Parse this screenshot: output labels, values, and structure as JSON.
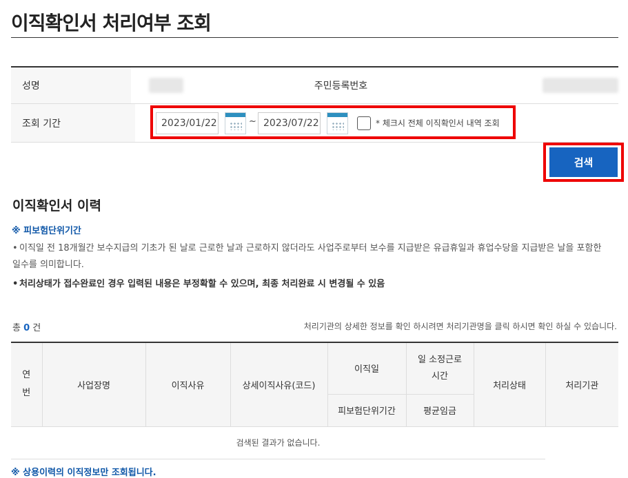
{
  "page": {
    "title": "이직확인서 처리여부 조회"
  },
  "form": {
    "name_label": "성명",
    "id_label": "주민등록번호",
    "period_label": "조회 기간",
    "start_date": "2023/01/22",
    "end_date": "2023/07/22",
    "tilde": "~",
    "check_note": "* 체크시 전체 이직확인서 내역 조회",
    "search_label": "검색"
  },
  "history": {
    "title": "이직확인서 이력",
    "note_head": "※ 피보험단위기간",
    "bullet1": "이직일 전 18개월간 보수지급의 기초가 된 날로 근로한 날과 근로하지 않더라도 사업주로부터 보수를 지급받은 유급휴일과 휴업수당을 지급받은 날을 포함한 일수를 의미합니다.",
    "bullet2": "처리상태가 접수완료인 경우 입력된 내용은 부정확할 수 있으며, 최종 처리완료 시 변경될 수 있음",
    "total_prefix": "총",
    "total_count": "0",
    "total_suffix": "건",
    "hint": "처리기관의 상세한 정보를 확인 하시려면 처리기관명을 클릭 하시면 확인 하실 수 있습니다."
  },
  "table": {
    "col_no": "연\n번",
    "col_company": "사업장명",
    "col_reason": "이직사유",
    "col_detail": "상세이직사유(코드)",
    "col_leave_date": "이직일",
    "col_hours": "일 소정근로\n시간",
    "col_status": "처리상태",
    "col_office": "처리기관",
    "col_insured_period": "피보험단위기간",
    "col_avg_wage": "평균임금",
    "empty_text": "검색된 결과가 없습니다."
  },
  "footer": {
    "note": "※ 상용이력의 이직정보만 조회됩니다."
  }
}
